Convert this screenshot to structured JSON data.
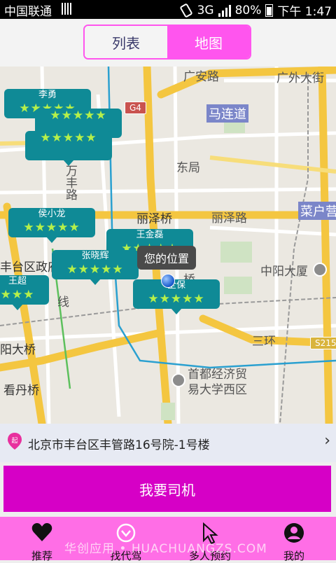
{
  "status_bar": {
    "carrier": "中国联通",
    "network": "3G",
    "battery": "80%",
    "time": "下午 1:47"
  },
  "tabs": [
    {
      "label": "列表",
      "active": false
    },
    {
      "label": "地图",
      "active": true
    }
  ],
  "map": {
    "labels": {
      "guanganlu": "广安路",
      "guangwai": "广外大街",
      "g4": "G4",
      "malian": "马连道",
      "wanfeng": "万丰路",
      "dongju": "东局",
      "lize": "丽泽桥",
      "lizelu": "丽泽路",
      "caihu": "菜户营",
      "fengtai": "丰台区政府",
      "xian": "线",
      "zhongyang": "中阳大厦",
      "sanhuan": "三环",
      "s215": "S215",
      "yangda": "阳大桥",
      "shoudu1": "首都经济贸",
      "shoudu2": "易大学西区",
      "kandan": "看丹桥",
      "qiao": "桥"
    },
    "drivers": [
      {
        "name": "李勇",
        "stars": "★★★★★"
      },
      {
        "name": "",
        "stars": "★★★★★"
      },
      {
        "name": "",
        "stars": "★★★★★"
      },
      {
        "name": "侯小龙",
        "stars": "★★★★★"
      },
      {
        "name": "王金磊",
        "stars": "★★★★★"
      },
      {
        "name": "张晓辉",
        "stars": "★★★★★"
      },
      {
        "name": "王超",
        "stars": "★★★"
      },
      {
        "name": "全保",
        "stars": "★★★★★"
      }
    ],
    "my_location_label": "您的位置"
  },
  "address": {
    "start_icon_text": "起",
    "text": "北京市丰台区丰管路16号院-1号楼"
  },
  "call_button": "我要司机",
  "nav": [
    {
      "label": "推荐",
      "icon": "heart-icon"
    },
    {
      "label": "找代驾",
      "icon": "chevron-circle-icon"
    },
    {
      "label": "多人预约",
      "icon": "cursor-icon"
    },
    {
      "label": "我的",
      "icon": "person-icon"
    }
  ],
  "watermark": "华创应用 • HUACHUANGZS.COM"
}
